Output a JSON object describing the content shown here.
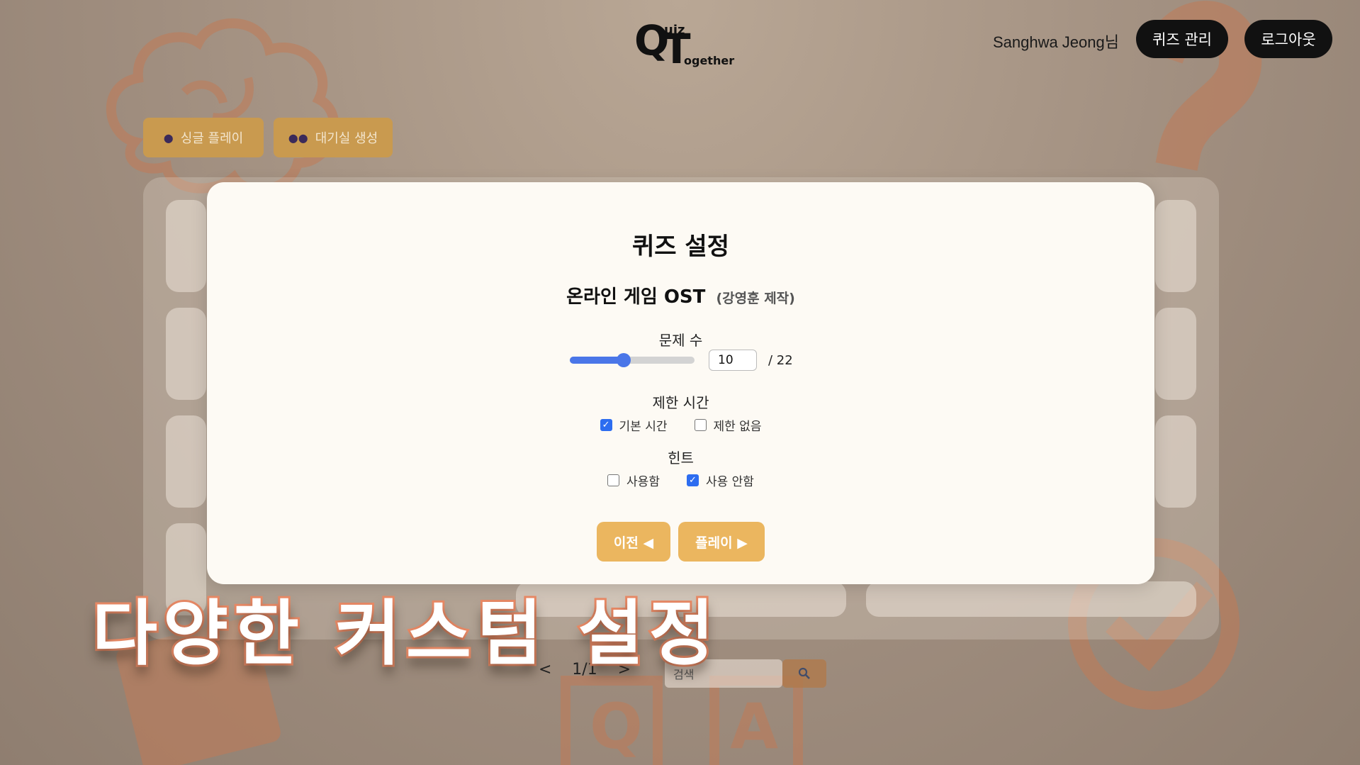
{
  "header": {
    "logo": {
      "q": "Q",
      "t": "T",
      "uiz": "uiz",
      "ogether": "ogether"
    },
    "user_name": "Sanghwa Jeong님",
    "quiz_manage_label": "퀴즈 관리",
    "logout_label": "로그아웃"
  },
  "modes": {
    "single_label": "싱글 플레이",
    "single_icon": "person-icon",
    "room_label": "대기실 생성",
    "room_icon": "group-icon"
  },
  "background": {
    "pager": {
      "prev": "<",
      "page": "1/1",
      "next": ">"
    },
    "search_placeholder": "검색",
    "search_icon": "search-icon"
  },
  "modal": {
    "title": "퀴즈 설정",
    "quiz_name": "온라인 게임 OST",
    "quiz_author": "(강영훈 제작)",
    "question_count": {
      "label": "문제 수",
      "value": "10",
      "total": "/ 22",
      "slider_fraction": 0.43
    },
    "time_limit": {
      "label": "제한 시간",
      "options": [
        {
          "label": "기본 시간",
          "checked": true
        },
        {
          "label": "제한 없음",
          "checked": false
        }
      ]
    },
    "hint": {
      "label": "힌트",
      "options": [
        {
          "label": "사용함",
          "checked": false
        },
        {
          "label": "사용 안함",
          "checked": true
        }
      ]
    },
    "prev_label": "이전 ◀",
    "play_label": "플레이 ▶"
  },
  "caption": "다양한 커스텀 설정",
  "colors": {
    "accent": "#ebb65f",
    "slider": "#4a76e8",
    "checkbox": "#2d6df0",
    "caption_stroke": "#e98a66"
  }
}
